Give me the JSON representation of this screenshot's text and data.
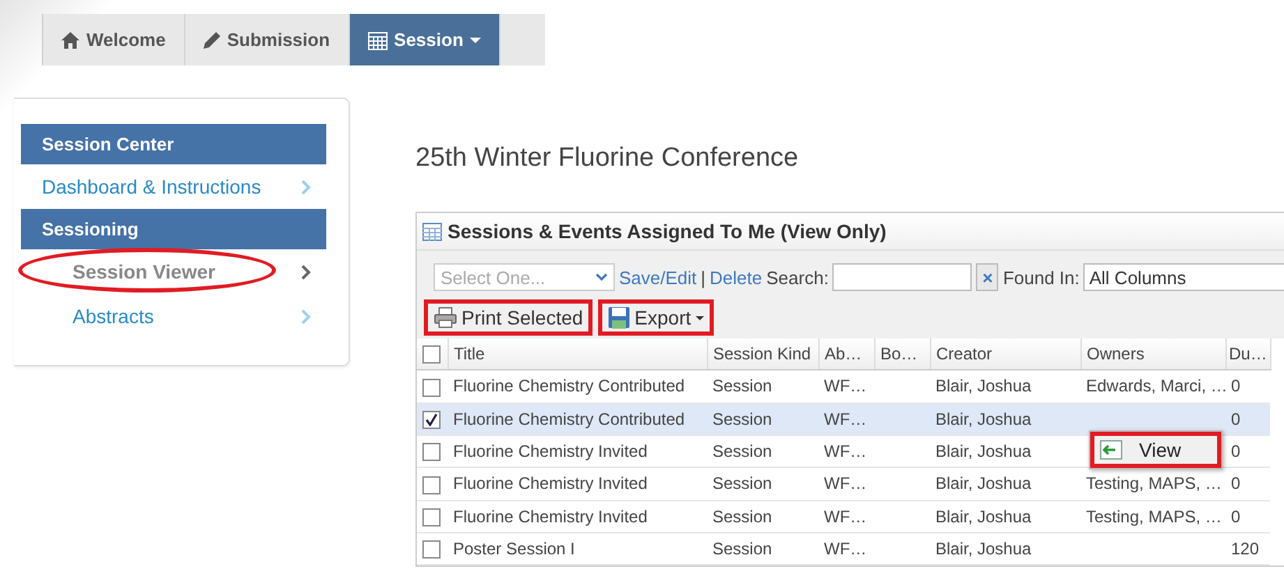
{
  "nav": {
    "tabs": [
      {
        "label": "Welcome",
        "selected": false,
        "dropdown": false
      },
      {
        "label": "Submission",
        "selected": false,
        "dropdown": false
      },
      {
        "label": "Session",
        "selected": true,
        "dropdown": true
      }
    ]
  },
  "sidebar": {
    "sections": [
      {
        "title": "Session Center",
        "items": [
          {
            "label": "Dashboard & Instructions",
            "current": false,
            "indented": false,
            "circled": false
          }
        ]
      },
      {
        "title": "Sessioning",
        "items": [
          {
            "label": "Session Viewer",
            "current": true,
            "indented": true,
            "circled": true
          },
          {
            "label": "Abstracts",
            "current": false,
            "indented": true,
            "circled": false
          }
        ]
      }
    ]
  },
  "page_title": "25th Winter Fluorine Conference",
  "panel": {
    "title": "Sessions & Events Assigned To Me (View Only)",
    "filter": {
      "placeholder": "Select One...",
      "save_link": "Save/Edit",
      "separator": "|",
      "delete_link": "Delete",
      "search_label": "Search:",
      "clear": "×",
      "found_in_label": "Found In:",
      "found_in_value": "All Columns"
    },
    "buttons": [
      {
        "label": "Print Selected",
        "kind": "print",
        "highlighted": true
      },
      {
        "label": "Export",
        "kind": "export",
        "highlighted": true
      }
    ],
    "table": {
      "all_checked": false,
      "columns": [
        "Title",
        "Session Kind",
        "Ab…",
        "Bo…",
        "Creator",
        "Owners",
        "Du…"
      ],
      "rows": [
        {
          "checked": false,
          "selected": false,
          "cells": [
            "Fluorine Chemistry Contributed",
            "Session",
            "WF…",
            "",
            "Blair, Joshua",
            "Edwards, Marci, …",
            "0"
          ]
        },
        {
          "checked": true,
          "selected": true,
          "cells": [
            "Fluorine Chemistry Contributed",
            "Session",
            "WF…",
            "",
            "Blair, Joshua",
            "",
            "0"
          ]
        },
        {
          "checked": false,
          "selected": false,
          "cells": [
            "Fluorine Chemistry Invited",
            "Session",
            "WF…",
            "",
            "Blair, Joshua",
            "",
            "0"
          ]
        },
        {
          "checked": false,
          "selected": false,
          "cells": [
            "Fluorine Chemistry Invited",
            "Session",
            "WF…",
            "",
            "Blair, Joshua",
            "Testing, MAPS, …",
            "0"
          ]
        },
        {
          "checked": false,
          "selected": false,
          "cells": [
            "Fluorine Chemistry Invited",
            "Session",
            "WF…",
            "",
            "Blair, Joshua",
            "Testing, MAPS, …",
            "0"
          ]
        },
        {
          "checked": false,
          "selected": false,
          "cells": [
            "Poster Session I",
            "Session",
            "WF…",
            "",
            "Blair, Joshua",
            "",
            "120"
          ]
        }
      ]
    },
    "context_menu": {
      "items": [
        {
          "label": "View",
          "highlighted": true
        }
      ]
    }
  }
}
